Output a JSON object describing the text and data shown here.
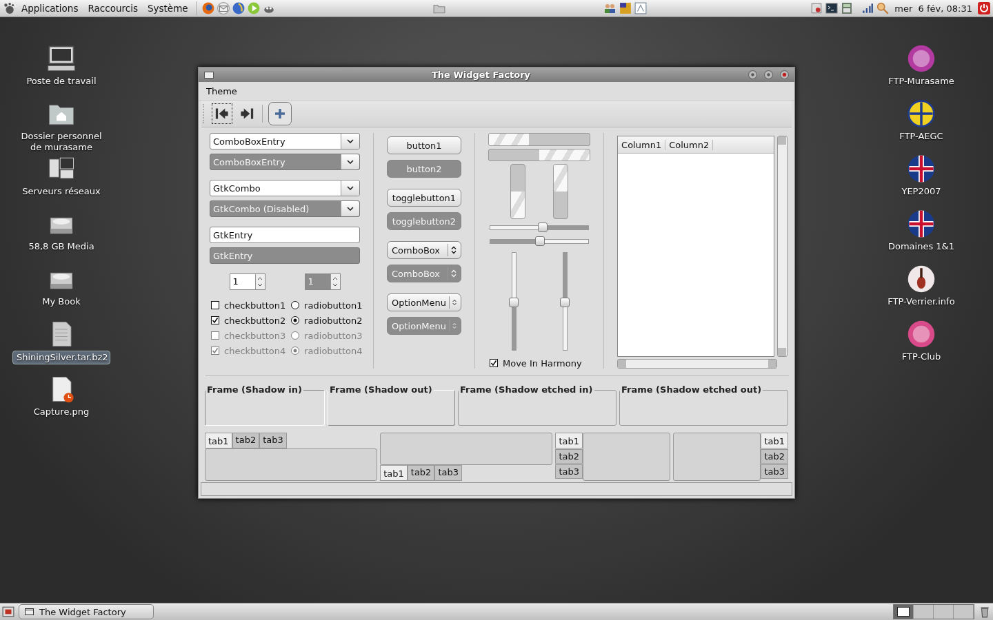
{
  "top_panel": {
    "menus": [
      "Applications",
      "Raccourcis",
      "Système"
    ],
    "clock": "mer  6 fév, 08:31"
  },
  "desktop_left": [
    {
      "label": "Poste de travail",
      "kind": "computer",
      "selected": false
    },
    {
      "label": "Dossier personnel de murasame",
      "kind": "home",
      "selected": false
    },
    {
      "label": "Serveurs réseaux",
      "kind": "network",
      "selected": false
    },
    {
      "label": "58,8 GB Media",
      "kind": "drive",
      "selected": false
    },
    {
      "label": "My Book",
      "kind": "drive",
      "selected": false
    },
    {
      "label": "ShiningSilver.tar.bz2",
      "kind": "archive",
      "selected": true
    },
    {
      "label": "Capture.png",
      "kind": "image",
      "selected": false
    }
  ],
  "desktop_right": [
    {
      "label": "FTP-Murasame",
      "kind": "purple",
      "selected": false
    },
    {
      "label": "FTP-AEGC",
      "kind": "emblem",
      "selected": false
    },
    {
      "label": "YEP2007",
      "kind": "flag",
      "selected": false
    },
    {
      "label": "Domaines 1&1",
      "kind": "flag",
      "selected": false
    },
    {
      "label": "FTP-Verrier.info",
      "kind": "violin",
      "selected": false
    },
    {
      "label": "FTP-Club",
      "kind": "club",
      "selected": false
    }
  ],
  "window": {
    "title": "The Widget Factory",
    "menu": [
      "Theme"
    ],
    "entries": [
      {
        "kind": "combo",
        "value": "ComboBoxEntry",
        "disabled": false
      },
      {
        "kind": "combo",
        "value": "ComboBoxEntry",
        "disabled": true
      },
      {
        "kind": "combo",
        "value": "GtkCombo",
        "disabled": false
      },
      {
        "kind": "combo",
        "value": "GtkCombo (Disabled)",
        "disabled": true
      },
      {
        "kind": "entry",
        "value": "GtkEntry",
        "disabled": false
      },
      {
        "kind": "entry",
        "value": "GtkEntry",
        "disabled": true
      }
    ],
    "spins": [
      {
        "value": "1",
        "disabled": false
      },
      {
        "value": "1",
        "disabled": true
      }
    ],
    "checks": [
      {
        "label": "checkbutton1",
        "checked": false,
        "disabled": false
      },
      {
        "label": "checkbutton2",
        "checked": true,
        "disabled": false
      },
      {
        "label": "checkbutton3",
        "checked": false,
        "disabled": true
      },
      {
        "label": "checkbutton4",
        "checked": true,
        "disabled": true
      }
    ],
    "radios": [
      {
        "label": "radiobutton1",
        "selected": false,
        "disabled": false
      },
      {
        "label": "radiobutton2",
        "selected": true,
        "disabled": false
      },
      {
        "label": "radiobutton3",
        "selected": false,
        "disabled": true
      },
      {
        "label": "radiobutton4",
        "selected": true,
        "disabled": true
      }
    ],
    "buttons": [
      {
        "kind": "button",
        "label": "button1",
        "disabled": false
      },
      {
        "kind": "button",
        "label": "button2",
        "disabled": true
      },
      {
        "kind": "toggle",
        "label": "togglebutton1",
        "disabled": false
      },
      {
        "kind": "toggle",
        "label": "togglebutton2",
        "disabled": true
      },
      {
        "kind": "select",
        "label": "ComboBox",
        "disabled": false
      },
      {
        "kind": "select",
        "label": "ComboBox",
        "disabled": true
      },
      {
        "kind": "select",
        "label": "OptionMenu",
        "disabled": false
      },
      {
        "kind": "select",
        "label": "OptionMenu",
        "disabled": true
      }
    ],
    "hprogress": [
      {
        "level": 0.4,
        "inverted": false
      },
      {
        "level": 0.5,
        "inverted": true
      }
    ],
    "vprogress": [
      {
        "level": 0.5,
        "inverted": true
      },
      {
        "level": 0.5,
        "inverted": false
      }
    ],
    "hscales": [
      {
        "level": 0.53,
        "inverted": false
      },
      {
        "level": 0.5,
        "inverted": true
      }
    ],
    "vscales": [
      {
        "level": 0.5,
        "inverted": false
      },
      {
        "level": 0.5,
        "inverted": true
      }
    ],
    "harmony": {
      "label": "Move In Harmony",
      "checked": true
    },
    "tree_columns": [
      "Column1",
      "Column2"
    ],
    "frames": [
      {
        "label": "Frame (Shadow in)",
        "kind": "in"
      },
      {
        "label": "Frame (Shadow out)",
        "kind": "out"
      },
      {
        "label": "Frame (Shadow etched in)",
        "kind": "etchedin"
      },
      {
        "label": "Frame (Shadow etched out)",
        "kind": "etchedout"
      }
    ],
    "notebooks": [
      {
        "kind": "top",
        "tabs": [
          {
            "label": "tab1",
            "selected": true
          },
          {
            "label": "tab2",
            "selected": false
          },
          {
            "label": "tab3",
            "selected": false
          }
        ]
      },
      {
        "kind": "bottom",
        "tabs": [
          {
            "label": "tab1",
            "selected": true
          },
          {
            "label": "tab2",
            "selected": false
          },
          {
            "label": "tab3",
            "selected": false
          }
        ]
      },
      {
        "kind": "left",
        "tabs": [
          {
            "label": "tab1",
            "selected": true
          },
          {
            "label": "tab2",
            "selected": false
          },
          {
            "label": "tab3",
            "selected": false
          }
        ]
      },
      {
        "kind": "right",
        "tabs": [
          {
            "label": "tab1",
            "selected": true
          },
          {
            "label": "tab2",
            "selected": false
          },
          {
            "label": "tab3",
            "selected": false
          }
        ]
      }
    ]
  },
  "taskbar": {
    "tasks": [
      {
        "label": "The Widget Factory",
        "selected": false
      }
    ],
    "workspaces": [
      {
        "selected": true
      },
      {
        "selected": false
      },
      {
        "selected": false
      },
      {
        "selected": false
      }
    ]
  }
}
